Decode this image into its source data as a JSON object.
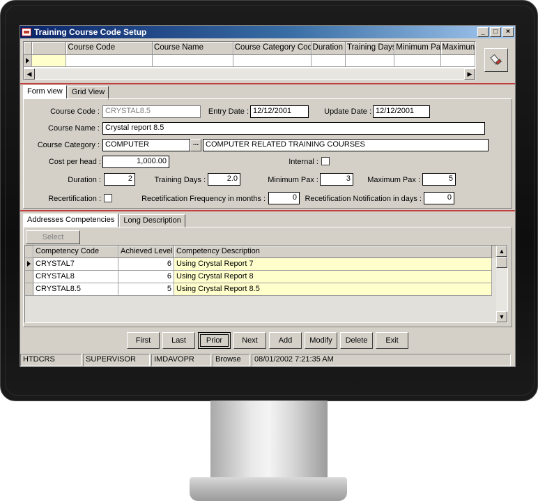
{
  "window": {
    "title": "Training Course Code Setup",
    "btn_min": "_",
    "btn_max": "□",
    "btn_close": "×"
  },
  "top_grid": {
    "columns": [
      "Course Code",
      "Course Name",
      "Course Category Code",
      "Duration",
      "Training Days",
      "Minimum Pax",
      "Maximun"
    ]
  },
  "tabs": {
    "form_view": "Form view",
    "grid_view": "Grid View"
  },
  "form": {
    "course_code_label": "Course Code :",
    "course_code": "CRYSTAL8.5",
    "entry_date_label": "Entry Date :",
    "entry_date": "12/12/2001",
    "update_date_label": "Update Date :",
    "update_date": "12/12/2001",
    "course_name_label": "Course Name :",
    "course_name": "Crystal report 8.5",
    "course_category_label": "Course Category :",
    "course_category": "COMPUTER",
    "course_category_desc": "COMPUTER RELATED TRAINING COURSES",
    "ellipsis": "...",
    "cost_label": "Cost per head :",
    "cost": "1,000.00",
    "internal_label": "Internal :",
    "duration_label": "Duration :",
    "duration": "2",
    "training_days_label": "Training Days :",
    "training_days": "2.0",
    "min_pax_label": "Minimum Pax :",
    "min_pax": "3",
    "max_pax_label": "Maximum Pax :",
    "max_pax": "5",
    "recert_label": "Recertification :",
    "recert_freq_label": "Recetification Frequency in months :",
    "recert_freq": "0",
    "recert_notif_label": "Recetification Notification in days :",
    "recert_notif": "0"
  },
  "subtabs": {
    "competencies": "Addresses Competencies",
    "long_desc": "Long Description"
  },
  "select_button": "Select",
  "competency_grid": {
    "columns": [
      "Competency Code",
      "Achieved Level",
      "Competency Description"
    ],
    "rows": [
      {
        "code": "CRYSTAL7",
        "level": "6",
        "desc": "Using Crystal Report 7"
      },
      {
        "code": "CRYSTAL8",
        "level": "6",
        "desc": "Using Crystal Report 8"
      },
      {
        "code": "CRYSTAL8.5",
        "level": "5",
        "desc": "Using Crystal Report 8.5"
      }
    ]
  },
  "nav": {
    "first": "First",
    "last": "Last",
    "prior": "Prior",
    "next": "Next",
    "add": "Add",
    "modify": "Modify",
    "delete": "Delete",
    "exit": "Exit"
  },
  "status": {
    "app": "HTDCRS",
    "user": "SUPERVISOR",
    "db": "IMDAVOPR",
    "mode": "Browse",
    "datetime": "08/01/2002 7:21:35 AM"
  }
}
